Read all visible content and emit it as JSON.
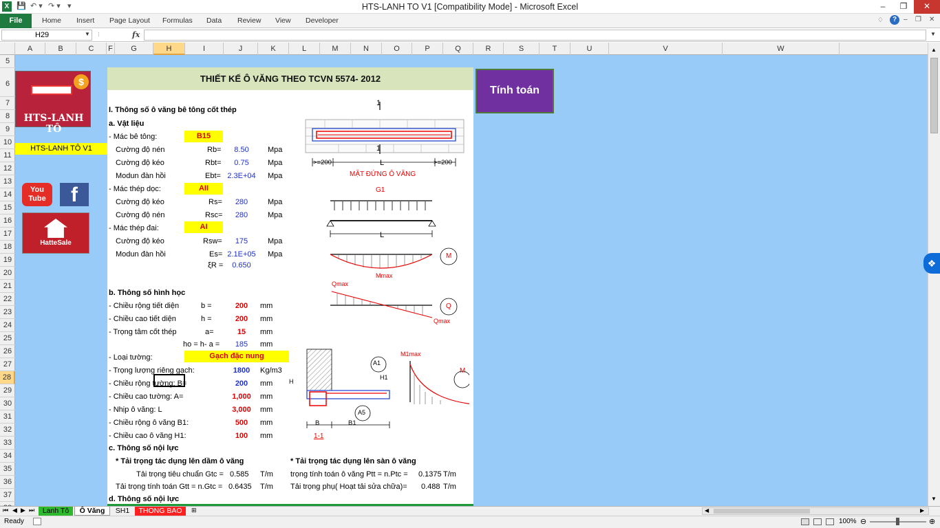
{
  "window": {
    "title": "HTS-LANH TO V1  [Compatibility Mode]  -  Microsoft Excel"
  },
  "ribbon": {
    "file": "File",
    "tabs": [
      "Home",
      "Insert",
      "Page Layout",
      "Formulas",
      "Data",
      "Review",
      "View",
      "Developer"
    ]
  },
  "formula_bar": {
    "name_box": "H29",
    "fx": "fx",
    "value": ""
  },
  "columns": [
    "A",
    "B",
    "C",
    "F",
    "G",
    "H",
    "I",
    "J",
    "K",
    "L",
    "M",
    "N",
    "O",
    "P",
    "Q",
    "R",
    "S",
    "T",
    "U",
    "V",
    "W"
  ],
  "rows": [
    "5",
    "6",
    "7",
    "8",
    "9",
    "10",
    "11",
    "12",
    "13",
    "14",
    "15",
    "16",
    "17",
    "18",
    "19",
    "20",
    "21",
    "22",
    "23",
    "24",
    "25",
    "26",
    "27",
    "28",
    "29",
    "30",
    "31",
    "32",
    "33",
    "34",
    "35",
    "36",
    "37",
    "38"
  ],
  "sidebar": {
    "logo_text": "HTS-LANH TÔ",
    "version": "HTS-LANH TÔ V1",
    "youtube": [
      "You",
      "Tube"
    ],
    "facebook": "f",
    "hattesale": "HatteSale"
  },
  "button": {
    "calc": "Tính toán"
  },
  "sheet": {
    "title": "THIẾT KẾ Ô VĂNG THEO TCVN 5574- 2012",
    "s1": "I. Thông số ô văng bê tông cốt thép",
    "s1a": "a. Vật liệu",
    "concrete_label": "- Mác bê tông:",
    "concrete": "B15",
    "rb_label": "Cường độ nén",
    "rb_sym": "Rb=",
    "rb": "8.50",
    "rb_unit": "Mpa",
    "rbt_label": "Cường độ kéo",
    "rbt_sym": "Rbt=",
    "rbt": "0.75",
    "rbt_unit": "Mpa",
    "eb_label": "Modun đàn hồi",
    "eb_sym": "Ebt=",
    "eb": "2.3E+04",
    "eb_unit": "Mpa",
    "steel_label": "- Mác thép dọc:",
    "steel": "AII",
    "rs_label": "Cường độ kéo",
    "rs_sym": "Rs=",
    "rs": "280",
    "rs_unit": "Mpa",
    "rsc_label": "Cường độ nén",
    "rsc_sym": "Rsc=",
    "rsc": "280",
    "rsc_unit": "Mpa",
    "stirrup_label": "- Mác thép đai:",
    "stirrup": "AI",
    "rsw_label": "Cường độ kéo",
    "rsw_sym": "Rsw=",
    "rsw": "175",
    "rsw_unit": "Mpa",
    "es_label": "Modun đàn hồi",
    "es_sym": "Es=",
    "es": "2.1E+05",
    "es_unit": "Mpa",
    "xi_sym": "ξR =",
    "xi": "0.650",
    "s1b": "b. Thông số hình học",
    "b_label": "- Chiều rộng tiết diện",
    "b_sym": "b =",
    "b": "200",
    "b_unit": "mm",
    "h_label": "- Chiều cao tiết diện",
    "h_sym": "h =",
    "h": "200",
    "h_unit": "mm",
    "a_label": "- Trọng tâm cốt thép",
    "a_sym": "a=",
    "a": "15",
    "a_unit": "mm",
    "ho_sym": "ho = h- a =",
    "ho": "185",
    "ho_unit": "mm",
    "wall_label": "- Loại tường:",
    "wall": "Gạch đặc nung",
    "gamma_label": "- Trọng lượng riêng gạch:",
    "gamma": "1800",
    "gamma_unit": "Kg/m3",
    "bw_label": "- Chiều rộng tường:  B=",
    "bw": "200",
    "bw_unit": "mm",
    "hw_label": "- Chiều cao tường: A=",
    "hw": "1,000",
    "hw_unit": "mm",
    "l_label": "- Nhịp ô văng: L",
    "l": "3,000",
    "l_unit": "mm",
    "b1_label": "- Chiều rộng ô văng B1:",
    "b1": "500",
    "b1_unit": "mm",
    "h1_label": "- Chiều cao ô văng H1:",
    "h1": "100",
    "h1_unit": "mm",
    "s1c": "c. Thông số nội lực",
    "load1": "* Tải trọng tác dụng lên dầm ô văng",
    "load2": "* Tải trọng tác dụng lên sàn ô văng",
    "gtc_label": "Tải trọng tiêu chuẩn Gtc =",
    "gtc": "0.585",
    "gtc_unit": "T/m",
    "gtt_label": "Tải trọng tính toán Gtt = n.Gtc =",
    "gtt": "0.6435",
    "gtt_unit": "T/m",
    "ptt_label": "trọng tính toán ô văng  Ptt = n.Ptc =",
    "ptt": "0.1375",
    "ptt_unit": "T/m",
    "pp_label": "Tải trọng phụ( Hoạt tải sửa chữa)=",
    "pp": "0.488",
    "pp_unit": "T/m",
    "s1d": "d. Thông số nội lực"
  },
  "diagram": {
    "elev_caption": "MẶT ĐỨNG Ô VĂNG",
    "cut": "1",
    "dim_left": ">=200",
    "dim_right": ">=200",
    "span": "L",
    "load": "G1",
    "mmax": "Mmax",
    "qmax": "Qmax",
    "m": "M",
    "q": "Q",
    "a1": "A1",
    "a5": "A5",
    "sec_b": "B",
    "sec_b1": "B1",
    "sec_h": "H",
    "sec_h1": "H1",
    "section": "1-1",
    "m1max": "M1max"
  },
  "sheets": [
    "Lanh Tô",
    "Ô Văng",
    "SH1",
    "THONG BAO"
  ],
  "status": {
    "ready": "Ready",
    "zoom": "100%"
  }
}
